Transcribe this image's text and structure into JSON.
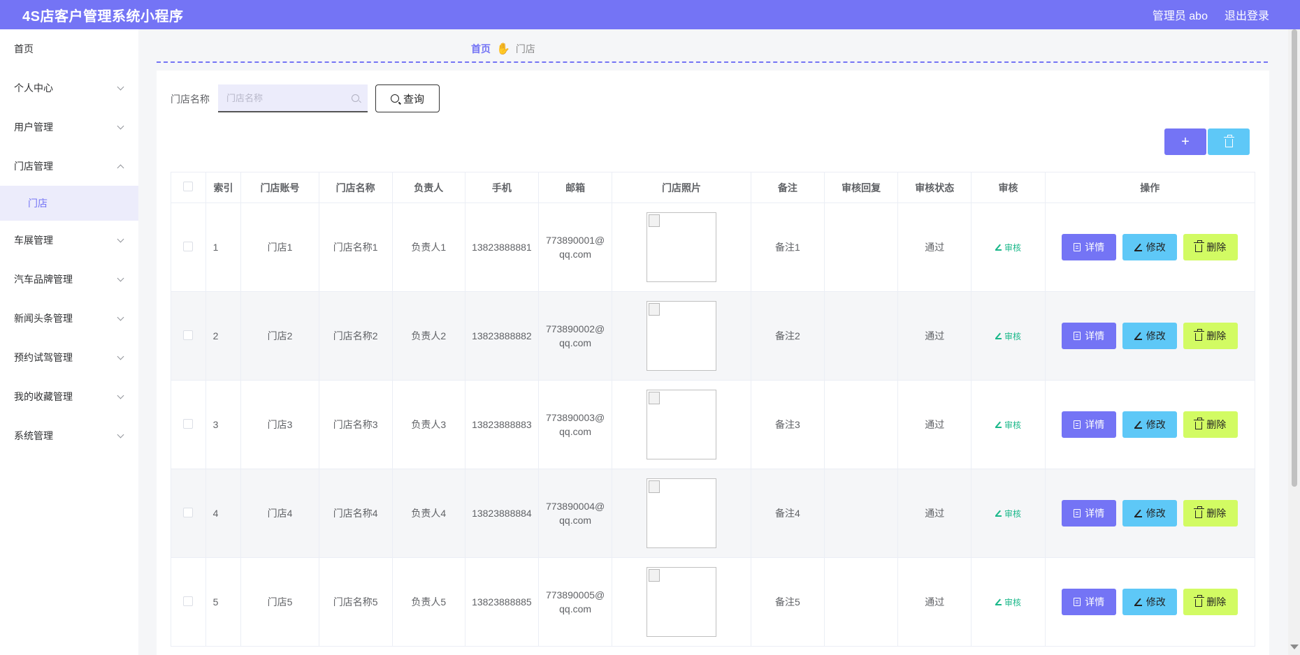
{
  "app": {
    "title": "4S店客户管理系统小程序",
    "admin_label": "管理员 abo",
    "logout_label": "退出登录"
  },
  "sidebar": {
    "items": [
      {
        "label": "首页",
        "has_arrow": false
      },
      {
        "label": "个人中心",
        "has_arrow": true
      },
      {
        "label": "用户管理",
        "has_arrow": true
      },
      {
        "label": "门店管理",
        "has_arrow": true,
        "expanded": true
      },
      {
        "label": "车展管理",
        "has_arrow": true
      },
      {
        "label": "汽车品牌管理",
        "has_arrow": true
      },
      {
        "label": "新闻头条管理",
        "has_arrow": true
      },
      {
        "label": "预约试驾管理",
        "has_arrow": true
      },
      {
        "label": "我的收藏管理",
        "has_arrow": true
      },
      {
        "label": "系统管理",
        "has_arrow": true
      }
    ],
    "submenu_active": "门店"
  },
  "breadcrumb": {
    "home": "首页",
    "separator_icon": "hand-icon",
    "current": "门店"
  },
  "search": {
    "label": "门店名称",
    "placeholder": "门店名称",
    "value": "",
    "query_label": "查询"
  },
  "toolbar": {
    "add_symbol": "+",
    "add_color": "#7474f5",
    "delete_color": "#5ec8f7"
  },
  "table": {
    "headers": [
      "索引",
      "门店账号",
      "门店名称",
      "负责人",
      "手机",
      "邮箱",
      "门店照片",
      "备注",
      "审核回复",
      "审核状态",
      "审核",
      "操作"
    ],
    "rows": [
      {
        "index": "1",
        "account": "门店1",
        "name": "门店名称1",
        "manager": "负责人1",
        "phone": "13823888881",
        "email": "773890001@qq.com",
        "remark": "备注1",
        "reply": "",
        "status": "通过"
      },
      {
        "index": "2",
        "account": "门店2",
        "name": "门店名称2",
        "manager": "负责人2",
        "phone": "13823888882",
        "email": "773890002@qq.com",
        "remark": "备注2",
        "reply": "",
        "status": "通过"
      },
      {
        "index": "3",
        "account": "门店3",
        "name": "门店名称3",
        "manager": "负责人3",
        "phone": "13823888883",
        "email": "773890003@qq.com",
        "remark": "备注3",
        "reply": "",
        "status": "通过"
      },
      {
        "index": "4",
        "account": "门店4",
        "name": "门店名称4",
        "manager": "负责人4",
        "phone": "13823888884",
        "email": "773890004@qq.com",
        "remark": "备注4",
        "reply": "",
        "status": "通过"
      },
      {
        "index": "5",
        "account": "门店5",
        "name": "门店名称5",
        "manager": "负责人5",
        "phone": "13823888885",
        "email": "773890005@qq.com",
        "remark": "备注5",
        "reply": "",
        "status": "通过"
      }
    ],
    "audit_label": "审核",
    "detail_label": "详情",
    "edit_label": "修改",
    "delete_label": "删除"
  },
  "colors": {
    "primary": "#7474f5",
    "info": "#5ec8f7",
    "warning": "#d2fb63",
    "success_text": "#1bb88a"
  }
}
